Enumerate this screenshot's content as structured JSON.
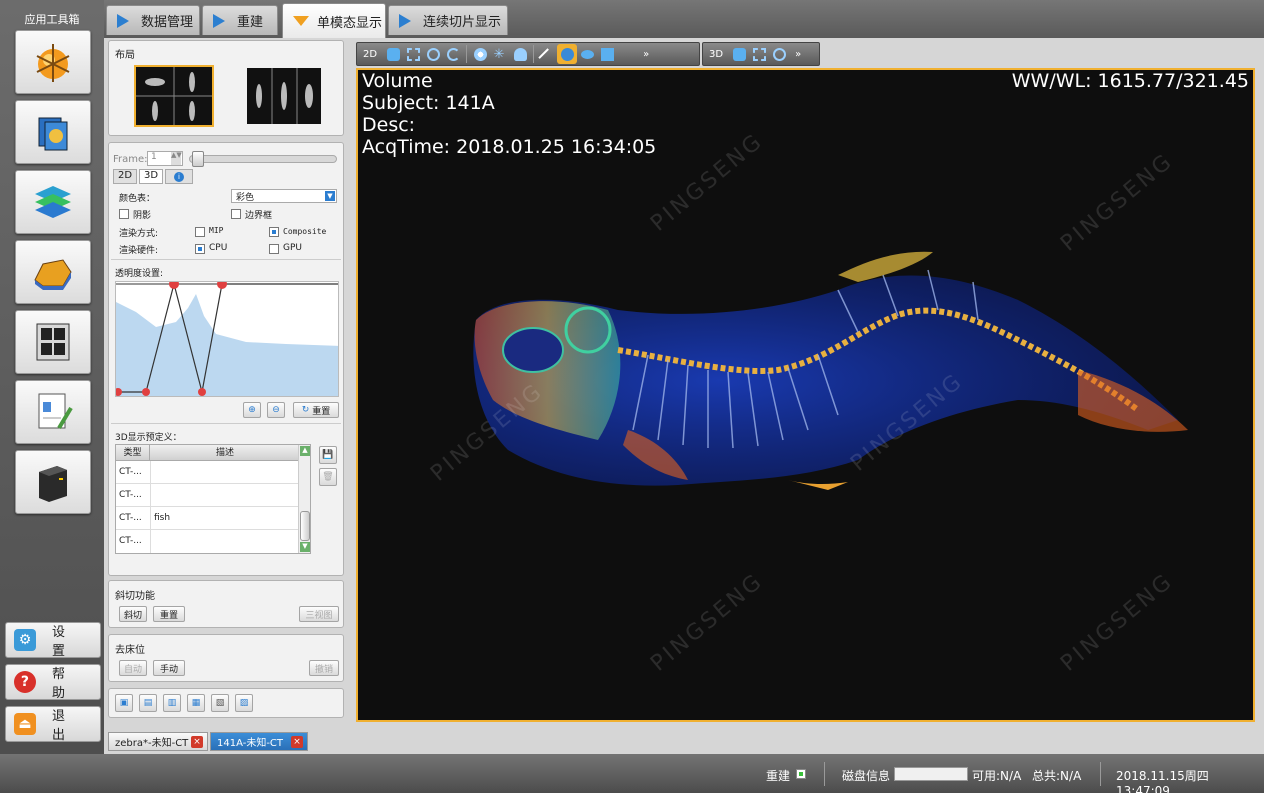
{
  "sidebar": {
    "title": "应用工具箱",
    "tools": [
      "data-management-icon",
      "reconstruction-icon",
      "slice-stack-icon",
      "volume-render-icon",
      "multi-view-icon",
      "report-icon",
      "server-icon"
    ],
    "settings_label": "设 置",
    "help_label": "帮 助",
    "exit_label": "退 出"
  },
  "top_tabs": [
    {
      "label": "数据管理",
      "active": false
    },
    {
      "label": "重建",
      "active": false
    },
    {
      "label": "单模态显示",
      "active": true
    },
    {
      "label": "连续切片显示",
      "active": false
    }
  ],
  "layout_panel": {
    "title": "布局"
  },
  "controls": {
    "frame_label": "Frame:",
    "frame_value": "1",
    "tabs": [
      "2D",
      "3D",
      "i"
    ],
    "colormap_label": "颜色表：",
    "colormap_value": "彩色",
    "shadow_label": "阴影",
    "border_label": "边界框",
    "render_mode_label": "渲染方式:",
    "mip_label": "MIP",
    "composite_label": "Composite",
    "hardware_label": "渲染硬件:",
    "cpu_label": "CPU",
    "gpu_label": "GPU",
    "transparency_label": "透明度设置:",
    "reset_label": "重置",
    "preset_label": "3D显示预定义：",
    "preset_headers": [
      "类型",
      "描述"
    ],
    "presets": [
      {
        "type": "CT-...",
        "desc": ""
      },
      {
        "type": "CT-...",
        "desc": ""
      },
      {
        "type": "CT-...",
        "desc": "fish"
      },
      {
        "type": "CT-...",
        "desc": ""
      }
    ]
  },
  "oblique": {
    "title": "斜切功能",
    "cut_label": "斜切",
    "reset_label": "重置",
    "three_view_label": "三视图"
  },
  "bed_removal": {
    "title": "去床位",
    "auto_label": "自动",
    "manual_label": "手动",
    "undo_label": "撤销"
  },
  "viewer": {
    "toolbar_2d_label": "2D",
    "toolbar_3d_label": "3D",
    "line1": "Volume",
    "line2": "Subject: 141A",
    "line3": "Desc:",
    "line4": "AcqTime: 2018.01.25 16:34:05",
    "wwwl": "WW/WL: 1615.77/321.45"
  },
  "doc_tabs": [
    {
      "label": "zebra*-未知-CT",
      "active": false
    },
    {
      "label": "141A-未知-CT",
      "active": true
    }
  ],
  "status": {
    "recon_label": "重建",
    "disk_label": "磁盘信息",
    "available": "可用:N/A",
    "total": "总共:N/A",
    "datetime": "2018.11.15周四 13:47:09"
  },
  "watermark": "PINGSENG",
  "colors": {
    "accent": "#2b7dd0",
    "active_border": "#f0b030",
    "viewer_bg": "#0e0e0e"
  }
}
